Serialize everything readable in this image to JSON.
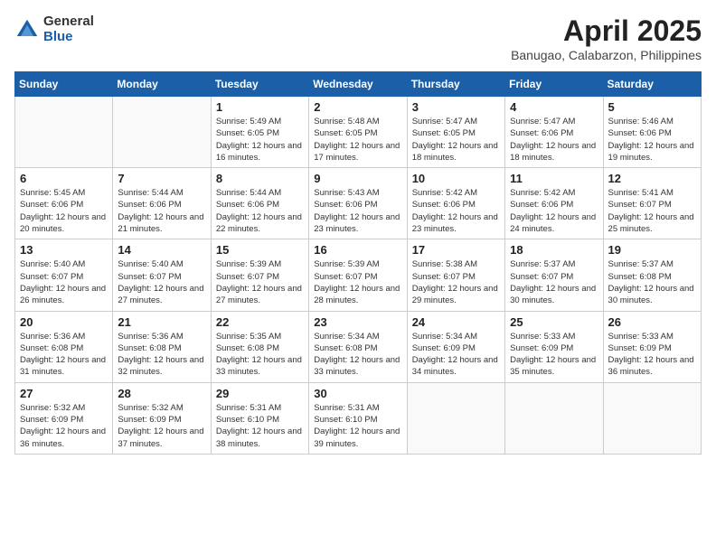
{
  "header": {
    "logo_general": "General",
    "logo_blue": "Blue",
    "month_title": "April 2025",
    "location": "Banugao, Calabarzon, Philippines"
  },
  "weekdays": [
    "Sunday",
    "Monday",
    "Tuesday",
    "Wednesday",
    "Thursday",
    "Friday",
    "Saturday"
  ],
  "weeks": [
    [
      {
        "day": "",
        "sunrise": "",
        "sunset": "",
        "daylight": ""
      },
      {
        "day": "",
        "sunrise": "",
        "sunset": "",
        "daylight": ""
      },
      {
        "day": "1",
        "sunrise": "Sunrise: 5:49 AM",
        "sunset": "Sunset: 6:05 PM",
        "daylight": "Daylight: 12 hours and 16 minutes."
      },
      {
        "day": "2",
        "sunrise": "Sunrise: 5:48 AM",
        "sunset": "Sunset: 6:05 PM",
        "daylight": "Daylight: 12 hours and 17 minutes."
      },
      {
        "day": "3",
        "sunrise": "Sunrise: 5:47 AM",
        "sunset": "Sunset: 6:05 PM",
        "daylight": "Daylight: 12 hours and 18 minutes."
      },
      {
        "day": "4",
        "sunrise": "Sunrise: 5:47 AM",
        "sunset": "Sunset: 6:06 PM",
        "daylight": "Daylight: 12 hours and 18 minutes."
      },
      {
        "day": "5",
        "sunrise": "Sunrise: 5:46 AM",
        "sunset": "Sunset: 6:06 PM",
        "daylight": "Daylight: 12 hours and 19 minutes."
      }
    ],
    [
      {
        "day": "6",
        "sunrise": "Sunrise: 5:45 AM",
        "sunset": "Sunset: 6:06 PM",
        "daylight": "Daylight: 12 hours and 20 minutes."
      },
      {
        "day": "7",
        "sunrise": "Sunrise: 5:44 AM",
        "sunset": "Sunset: 6:06 PM",
        "daylight": "Daylight: 12 hours and 21 minutes."
      },
      {
        "day": "8",
        "sunrise": "Sunrise: 5:44 AM",
        "sunset": "Sunset: 6:06 PM",
        "daylight": "Daylight: 12 hours and 22 minutes."
      },
      {
        "day": "9",
        "sunrise": "Sunrise: 5:43 AM",
        "sunset": "Sunset: 6:06 PM",
        "daylight": "Daylight: 12 hours and 23 minutes."
      },
      {
        "day": "10",
        "sunrise": "Sunrise: 5:42 AM",
        "sunset": "Sunset: 6:06 PM",
        "daylight": "Daylight: 12 hours and 23 minutes."
      },
      {
        "day": "11",
        "sunrise": "Sunrise: 5:42 AM",
        "sunset": "Sunset: 6:06 PM",
        "daylight": "Daylight: 12 hours and 24 minutes."
      },
      {
        "day": "12",
        "sunrise": "Sunrise: 5:41 AM",
        "sunset": "Sunset: 6:07 PM",
        "daylight": "Daylight: 12 hours and 25 minutes."
      }
    ],
    [
      {
        "day": "13",
        "sunrise": "Sunrise: 5:40 AM",
        "sunset": "Sunset: 6:07 PM",
        "daylight": "Daylight: 12 hours and 26 minutes."
      },
      {
        "day": "14",
        "sunrise": "Sunrise: 5:40 AM",
        "sunset": "Sunset: 6:07 PM",
        "daylight": "Daylight: 12 hours and 27 minutes."
      },
      {
        "day": "15",
        "sunrise": "Sunrise: 5:39 AM",
        "sunset": "Sunset: 6:07 PM",
        "daylight": "Daylight: 12 hours and 27 minutes."
      },
      {
        "day": "16",
        "sunrise": "Sunrise: 5:39 AM",
        "sunset": "Sunset: 6:07 PM",
        "daylight": "Daylight: 12 hours and 28 minutes."
      },
      {
        "day": "17",
        "sunrise": "Sunrise: 5:38 AM",
        "sunset": "Sunset: 6:07 PM",
        "daylight": "Daylight: 12 hours and 29 minutes."
      },
      {
        "day": "18",
        "sunrise": "Sunrise: 5:37 AM",
        "sunset": "Sunset: 6:07 PM",
        "daylight": "Daylight: 12 hours and 30 minutes."
      },
      {
        "day": "19",
        "sunrise": "Sunrise: 5:37 AM",
        "sunset": "Sunset: 6:08 PM",
        "daylight": "Daylight: 12 hours and 30 minutes."
      }
    ],
    [
      {
        "day": "20",
        "sunrise": "Sunrise: 5:36 AM",
        "sunset": "Sunset: 6:08 PM",
        "daylight": "Daylight: 12 hours and 31 minutes."
      },
      {
        "day": "21",
        "sunrise": "Sunrise: 5:36 AM",
        "sunset": "Sunset: 6:08 PM",
        "daylight": "Daylight: 12 hours and 32 minutes."
      },
      {
        "day": "22",
        "sunrise": "Sunrise: 5:35 AM",
        "sunset": "Sunset: 6:08 PM",
        "daylight": "Daylight: 12 hours and 33 minutes."
      },
      {
        "day": "23",
        "sunrise": "Sunrise: 5:34 AM",
        "sunset": "Sunset: 6:08 PM",
        "daylight": "Daylight: 12 hours and 33 minutes."
      },
      {
        "day": "24",
        "sunrise": "Sunrise: 5:34 AM",
        "sunset": "Sunset: 6:09 PM",
        "daylight": "Daylight: 12 hours and 34 minutes."
      },
      {
        "day": "25",
        "sunrise": "Sunrise: 5:33 AM",
        "sunset": "Sunset: 6:09 PM",
        "daylight": "Daylight: 12 hours and 35 minutes."
      },
      {
        "day": "26",
        "sunrise": "Sunrise: 5:33 AM",
        "sunset": "Sunset: 6:09 PM",
        "daylight": "Daylight: 12 hours and 36 minutes."
      }
    ],
    [
      {
        "day": "27",
        "sunrise": "Sunrise: 5:32 AM",
        "sunset": "Sunset: 6:09 PM",
        "daylight": "Daylight: 12 hours and 36 minutes."
      },
      {
        "day": "28",
        "sunrise": "Sunrise: 5:32 AM",
        "sunset": "Sunset: 6:09 PM",
        "daylight": "Daylight: 12 hours and 37 minutes."
      },
      {
        "day": "29",
        "sunrise": "Sunrise: 5:31 AM",
        "sunset": "Sunset: 6:10 PM",
        "daylight": "Daylight: 12 hours and 38 minutes."
      },
      {
        "day": "30",
        "sunrise": "Sunrise: 5:31 AM",
        "sunset": "Sunset: 6:10 PM",
        "daylight": "Daylight: 12 hours and 39 minutes."
      },
      {
        "day": "",
        "sunrise": "",
        "sunset": "",
        "daylight": ""
      },
      {
        "day": "",
        "sunrise": "",
        "sunset": "",
        "daylight": ""
      },
      {
        "day": "",
        "sunrise": "",
        "sunset": "",
        "daylight": ""
      }
    ]
  ]
}
